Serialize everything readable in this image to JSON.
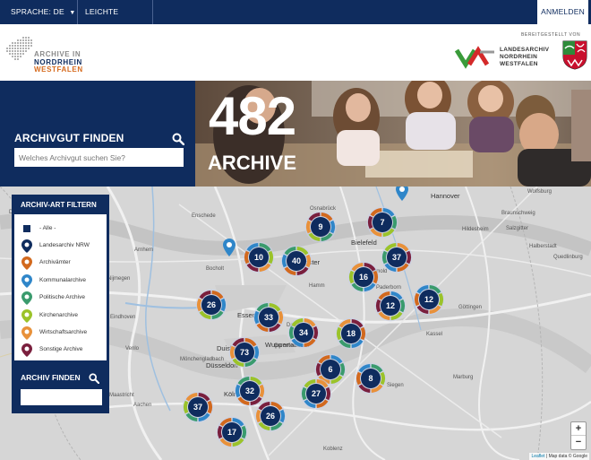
{
  "topbar": {
    "language_label": "SPRACHE:",
    "language_value": "DE",
    "easy_language": "LEICHTE SPRACHE",
    "login": "ANMELDEN"
  },
  "header": {
    "logo_line1": "ARCHIVE IN",
    "logo_line2": "NORDRHEIN",
    "logo_line3": "WESTFALEN",
    "provided_by": "BEREITGESTELLT VON",
    "lanrw_line1": "LANDESARCHIV",
    "lanrw_line2": "NORDRHEIN",
    "lanrw_line3": "WESTFALEN"
  },
  "hero": {
    "title": "ARCHIVGUT FINDEN",
    "search_placeholder": "Welches Archivgut suchen Sie?",
    "count": "482",
    "count_label": "ARCHIVE"
  },
  "filter": {
    "title": "ARCHIV-ART FILTERN",
    "items": [
      {
        "label": "- Alle -",
        "color": "#0f2c5e"
      },
      {
        "label": "Landesarchiv NRW",
        "color": "#0f2c5e"
      },
      {
        "label": "Archivämter",
        "color": "#d2691e"
      },
      {
        "label": "Kommunalarchive",
        "color": "#2f86c9"
      },
      {
        "label": "Politische Archive",
        "color": "#3a9b6d"
      },
      {
        "label": "Kirchenarchive",
        "color": "#9bc32a"
      },
      {
        "label": "Wirtschaftsarchive",
        "color": "#e8913a"
      },
      {
        "label": "Sonstige Archive",
        "color": "#7a1f3d"
      }
    ]
  },
  "find": {
    "title": "ARCHIV FINDEN",
    "placeholder": ""
  },
  "map": {
    "clusters": [
      "9",
      "7",
      "10",
      "40",
      "37",
      "16",
      "26",
      "12",
      "12",
      "33",
      "34",
      "18",
      "73",
      "6",
      "8",
      "32",
      "27",
      "37",
      "26",
      "17"
    ],
    "places": [
      "Hannover",
      "Wolfsburg",
      "Deventer",
      "Enschede",
      "Osnabrück",
      "Bielefeld",
      "Hildesheim",
      "Braunschweig",
      "Salzgitter",
      "Halberstadt",
      "Quedlinburg",
      "Arnhem",
      "Nijmegen",
      "Bocholt",
      "Münster",
      "Hamm",
      "Paderborn",
      "Detmold",
      "Göttingen",
      "Essen",
      "Dortmund",
      "Duisburg",
      "Wuppertal",
      "Düsseldorf",
      "Kassel",
      "Eindhoven",
      "Venlo",
      "Mönchengladbach",
      "Köln",
      "Gummersbach",
      "Siegen",
      "Marburg",
      "Maastricht",
      "Aachen",
      "Bonn",
      "Koblenz"
    ],
    "zoom_in": "+",
    "zoom_out": "−",
    "attribution_leaflet": "Leaflet",
    "attribution_data": "Map data © Google"
  }
}
